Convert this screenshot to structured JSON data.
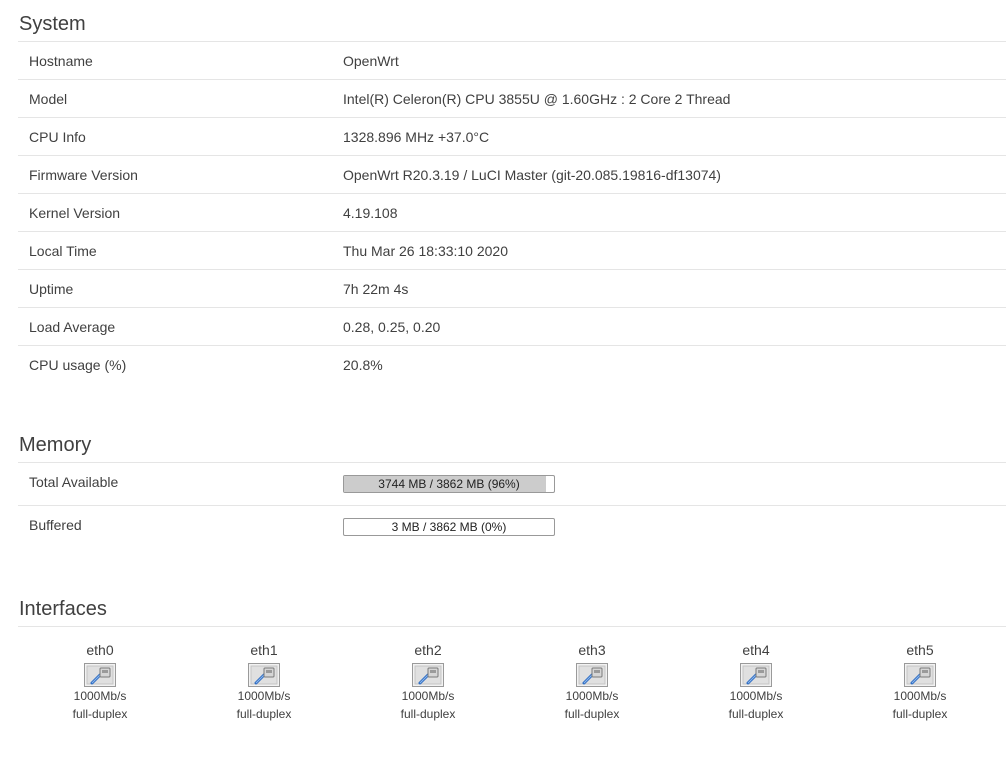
{
  "system": {
    "title": "System",
    "rows": [
      {
        "label": "Hostname",
        "value": "OpenWrt"
      },
      {
        "label": "Model",
        "value": "Intel(R) Celeron(R) CPU 3855U @ 1.60GHz : 2 Core 2 Thread"
      },
      {
        "label": "CPU Info",
        "value": "1328.896 MHz +37.0°C"
      },
      {
        "label": "Firmware Version",
        "value": "OpenWrt R20.3.19 / LuCI Master (git-20.085.19816-df13074)"
      },
      {
        "label": "Kernel Version",
        "value": "4.19.108"
      },
      {
        "label": "Local Time",
        "value": "Thu Mar 26 18:33:10 2020"
      },
      {
        "label": "Uptime",
        "value": "7h 22m 4s"
      },
      {
        "label": "Load Average",
        "value": "0.28, 0.25, 0.20"
      },
      {
        "label": "CPU usage (%)",
        "value": "20.8%"
      }
    ]
  },
  "memory": {
    "title": "Memory",
    "rows": [
      {
        "label": "Total Available",
        "text": "3744 MB / 3862 MB (96%)",
        "percent": 96
      },
      {
        "label": "Buffered",
        "text": "3 MB / 3862 MB (0%)",
        "percent": 0
      }
    ]
  },
  "interfaces": {
    "title": "Interfaces",
    "items": [
      {
        "name": "eth0",
        "speed": "1000Mb/s",
        "duplex": "full-duplex",
        "icon": "ethernet-port-icon"
      },
      {
        "name": "eth1",
        "speed": "1000Mb/s",
        "duplex": "full-duplex",
        "icon": "ethernet-port-icon"
      },
      {
        "name": "eth2",
        "speed": "1000Mb/s",
        "duplex": "full-duplex",
        "icon": "ethernet-port-icon"
      },
      {
        "name": "eth3",
        "speed": "1000Mb/s",
        "duplex": "full-duplex",
        "icon": "ethernet-port-icon"
      },
      {
        "name": "eth4",
        "speed": "1000Mb/s",
        "duplex": "full-duplex",
        "icon": "ethernet-port-icon"
      },
      {
        "name": "eth5",
        "speed": "1000Mb/s",
        "duplex": "full-duplex",
        "icon": "ethernet-port-icon"
      }
    ]
  }
}
